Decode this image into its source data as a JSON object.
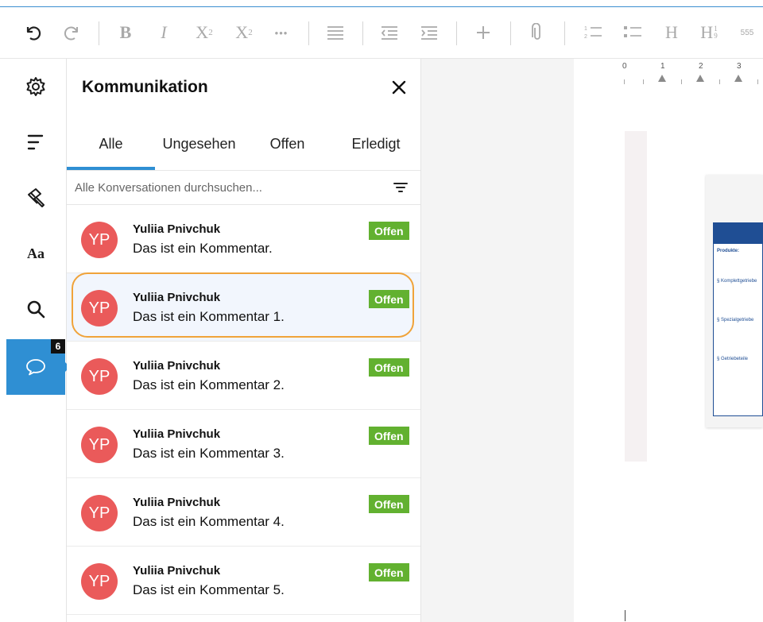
{
  "toolbar": {
    "bold": "B",
    "italic": "I",
    "superscript_base": "X",
    "superscript_sup": "2",
    "subscript_base": "X",
    "subscript_sub": "2",
    "more": "•••",
    "heading": "H",
    "heading_numbered": "H",
    "heading_numbered_sup": "1",
    "heading_numbered_sub": "9",
    "numbering": "555"
  },
  "rail": {
    "comments_badge": "6"
  },
  "panel": {
    "title": "Kommunikation",
    "tabs": [
      "Alle",
      "Ungesehen",
      "Offen",
      "Erledigt"
    ],
    "search_placeholder": "Alle Konversationen durchsuchen..."
  },
  "comments": [
    {
      "initials": "YP",
      "author": "Yuliia Pnivchuk",
      "text": "Das ist ein Kommentar.",
      "status": "Offen"
    },
    {
      "initials": "YP",
      "author": "Yuliia Pnivchuk",
      "text": "Das ist ein Kommentar 1.",
      "status": "Offen"
    },
    {
      "initials": "YP",
      "author": "Yuliia Pnivchuk",
      "text": "Das ist ein Kommentar 2.",
      "status": "Offen"
    },
    {
      "initials": "YP",
      "author": "Yuliia Pnivchuk",
      "text": "Das ist ein Kommentar 3.",
      "status": "Offen"
    },
    {
      "initials": "YP",
      "author": "Yuliia Pnivchuk",
      "text": "Das ist ein Kommentar 4.",
      "status": "Offen"
    },
    {
      "initials": "YP",
      "author": "Yuliia Pnivchuk",
      "text": "Das ist ein Kommentar 5.",
      "status": "Offen"
    }
  ],
  "ruler": {
    "marks": [
      "0",
      "1",
      "2",
      "3"
    ]
  },
  "document": {
    "heading": "Produkte:",
    "items": [
      "§ Komplettgetriebe",
      "§ Spezialgetriebe",
      "§ Getriebeteile"
    ]
  },
  "colors": {
    "accent": "#2f8fd3",
    "avatar": "#ea5a5a",
    "status_open": "#62b130",
    "selection": "#f0a33a"
  }
}
